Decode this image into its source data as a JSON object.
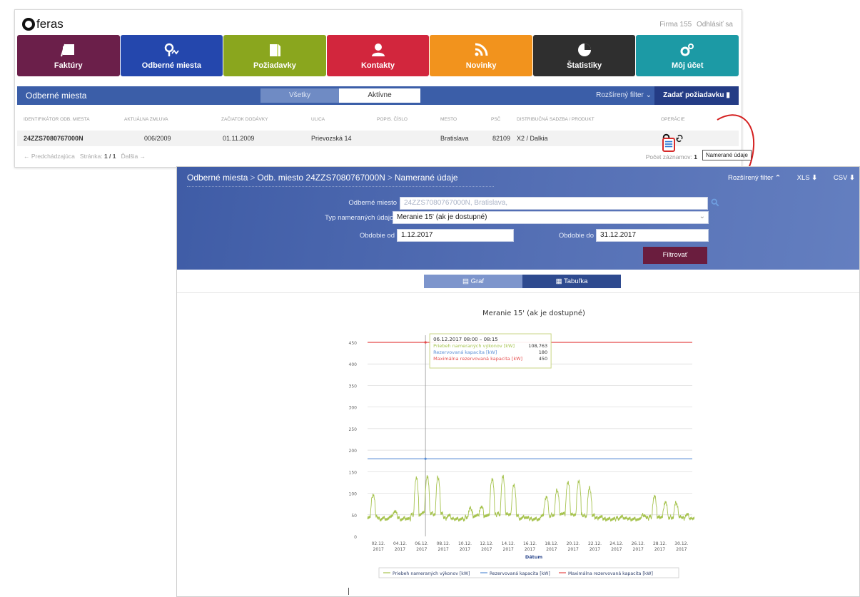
{
  "app": {
    "logo_text": "feras",
    "user_firm": "Firma 155",
    "logout": "Odhlásiť sa"
  },
  "tiles": [
    {
      "label": "Faktúry",
      "icon": "invoice-icon",
      "color": "#6b1f4a"
    },
    {
      "label": "Odberné miesta",
      "icon": "location-icon",
      "color": "#2447ad"
    },
    {
      "label": "Požiadavky",
      "icon": "request-icon",
      "color": "#8aa61e"
    },
    {
      "label": "Kontakty",
      "icon": "contact-icon",
      "color": "#d2263d"
    },
    {
      "label": "Novinky",
      "icon": "rss-icon",
      "color": "#f2931d"
    },
    {
      "label": "Štatistiky",
      "icon": "pie-icon",
      "color": "#2f2f2f"
    },
    {
      "label": "Môj účet",
      "icon": "gears-icon",
      "color": "#1c9aa5"
    }
  ],
  "list": {
    "title": "Odberné miesta",
    "tab_all": "Všetky",
    "tab_active": "Aktívne",
    "extended_filter": "Rozšírený filter",
    "submit_request": "Zadať požiadavku",
    "columns": [
      "Identifikátor odb. miesta",
      "Aktuálna zmluva",
      "Začiatok dodávky",
      "Ulica",
      "Popis. číslo",
      "Mesto",
      "PSČ",
      "Distribučná sadzba / produkt",
      "Operácie"
    ],
    "row": {
      "id": "24ZZS7080767000N",
      "contract": "006/2009",
      "start": "01.11.2009",
      "street": "Prievozská 14",
      "number": "",
      "city": "Bratislava",
      "zip": "82109",
      "rate": "X2 / Dalkia"
    },
    "pager": {
      "prev": "← Predchádzajúca",
      "page_label": "Stránka:",
      "page_value": "1 / 1",
      "next": "Ďalšia →"
    },
    "count_label": "Počet záznamov:",
    "count_value": "1",
    "tooltip": "Namerané údaje"
  },
  "panel": {
    "breadcrumb": [
      "Odberné miesta",
      "Odb. miesto 24ZZS7080767000N",
      "Namerané údaje"
    ],
    "ext_filter": "Rozšírený filter",
    "xls": "XLS",
    "csv": "CSV",
    "filter": {
      "place_label": "Odberné miesto",
      "place_value": "24ZZS7080767000N, Bratislava,",
      "type_label": "Typ nameraných údajov",
      "type_value": "Meranie 15' (ak je dostupné)",
      "from_label": "Obdobie od",
      "from_value": "1.12.2017",
      "to_label": "Obdobie do",
      "to_value": "31.12.2017",
      "button": "Filtrovať"
    },
    "tab_graph": "Graf",
    "tab_table": "Tabuľka"
  },
  "chart_data": {
    "type": "line",
    "title": "Meranie 15' (ak je dostupné)",
    "xlabel": "Dátum",
    "ylabel": "",
    "ylim": [
      0,
      450
    ],
    "yticks": [
      0,
      50,
      100,
      150,
      200,
      250,
      300,
      350,
      400,
      450
    ],
    "xticks": [
      [
        "02.12.",
        "2017"
      ],
      [
        "04.12.",
        "2017"
      ],
      [
        "06.12.",
        "2017"
      ],
      [
        "08.12.",
        "2017"
      ],
      [
        "10.12.",
        "2017"
      ],
      [
        "12.12.",
        "2017"
      ],
      [
        "14.12.",
        "2017"
      ],
      [
        "16.12.",
        "2017"
      ],
      [
        "18.12.",
        "2017"
      ],
      [
        "20.12.",
        "2017"
      ],
      [
        "22.12.",
        "2017"
      ],
      [
        "24.12.",
        "2017"
      ],
      [
        "26.12.",
        "2017"
      ],
      [
        "28.12.",
        "2017"
      ],
      [
        "30.12.",
        "2017"
      ]
    ],
    "grid": true,
    "legend_position": "bottom",
    "x_range_days": [
      1,
      31
    ],
    "series": [
      {
        "name": "Priebeh nameraných výkonov [kW]",
        "color": "#a6c34e",
        "daily_peaks": [
          98,
          42,
          58,
          42,
          135,
          140,
          138,
          48,
          40,
          65,
          68,
          135,
          138,
          120,
          45,
          40,
          92,
          108,
          125,
          130,
          112,
          45,
          40,
          45,
          40,
          50,
          92,
          80,
          78,
          50,
          45
        ],
        "daily_base": [
          45,
          40,
          45,
          40,
          50,
          55,
          52,
          42,
          40,
          45,
          48,
          50,
          52,
          50,
          42,
          40,
          48,
          50,
          52,
          50,
          48,
          42,
          40,
          42,
          40,
          42,
          45,
          44,
          44,
          42,
          42
        ]
      },
      {
        "name": "Rezervovaná kapacita [kW]",
        "color": "#5b8fd6",
        "constant": 180
      },
      {
        "name": "Maximálna rezervovaná kapacita [kW]",
        "color": "#e54a4a",
        "constant": 450
      }
    ],
    "tooltip": {
      "date": "06.12.2017 08:00 – 08:15",
      "rows": [
        {
          "label": "Priebeh nameraných výkonov [kW]",
          "value": "108,763",
          "color": "#a6c34e"
        },
        {
          "label": "Rezervovaná kapacita [kW]",
          "value": "180",
          "color": "#5b8fd6"
        },
        {
          "label": "Maximálna rezervovaná kapacita [kW]",
          "value": "450",
          "color": "#e54a4a"
        }
      ],
      "x_day": 6.35
    }
  }
}
